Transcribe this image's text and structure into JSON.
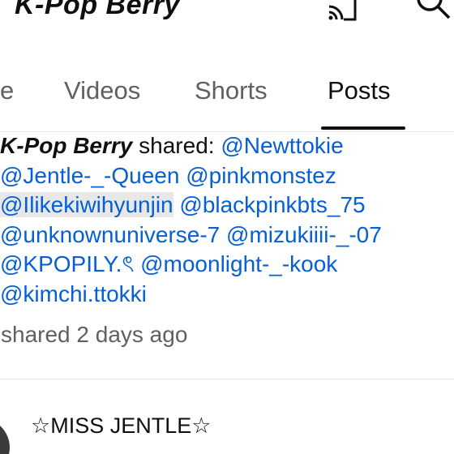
{
  "header": {
    "channel_title": "K-Pop Berry",
    "cast_icon": "cast-icon",
    "search_icon": "search-icon"
  },
  "tabs": [
    {
      "label": "e"
    },
    {
      "label": "Videos"
    },
    {
      "label": "Shorts"
    },
    {
      "label": "Posts",
      "selected": true
    }
  ],
  "post": {
    "author": "K-Pop Berry",
    "shared_text": " shared: ",
    "mentions": [
      "@Newttokie",
      "@Jentle-_-Queen",
      "@pinkmonstez",
      "@Ilikekiwihyunjin",
      "@blackpinkbts_75",
      "@unknownuniverse-7",
      "@mizukiiii-_-07",
      "@KPOPILY.ৎ",
      "@moonlight-_-kook",
      "@kimchi.ttokki"
    ],
    "time": "shared 2 days ago"
  },
  "next_post": {
    "author": "☆MISS JENTLE☆"
  },
  "colors": {
    "link": "#065fd4",
    "text": "#0f0f0f",
    "secondary": "#606060",
    "divider": "#e5e5e5"
  }
}
